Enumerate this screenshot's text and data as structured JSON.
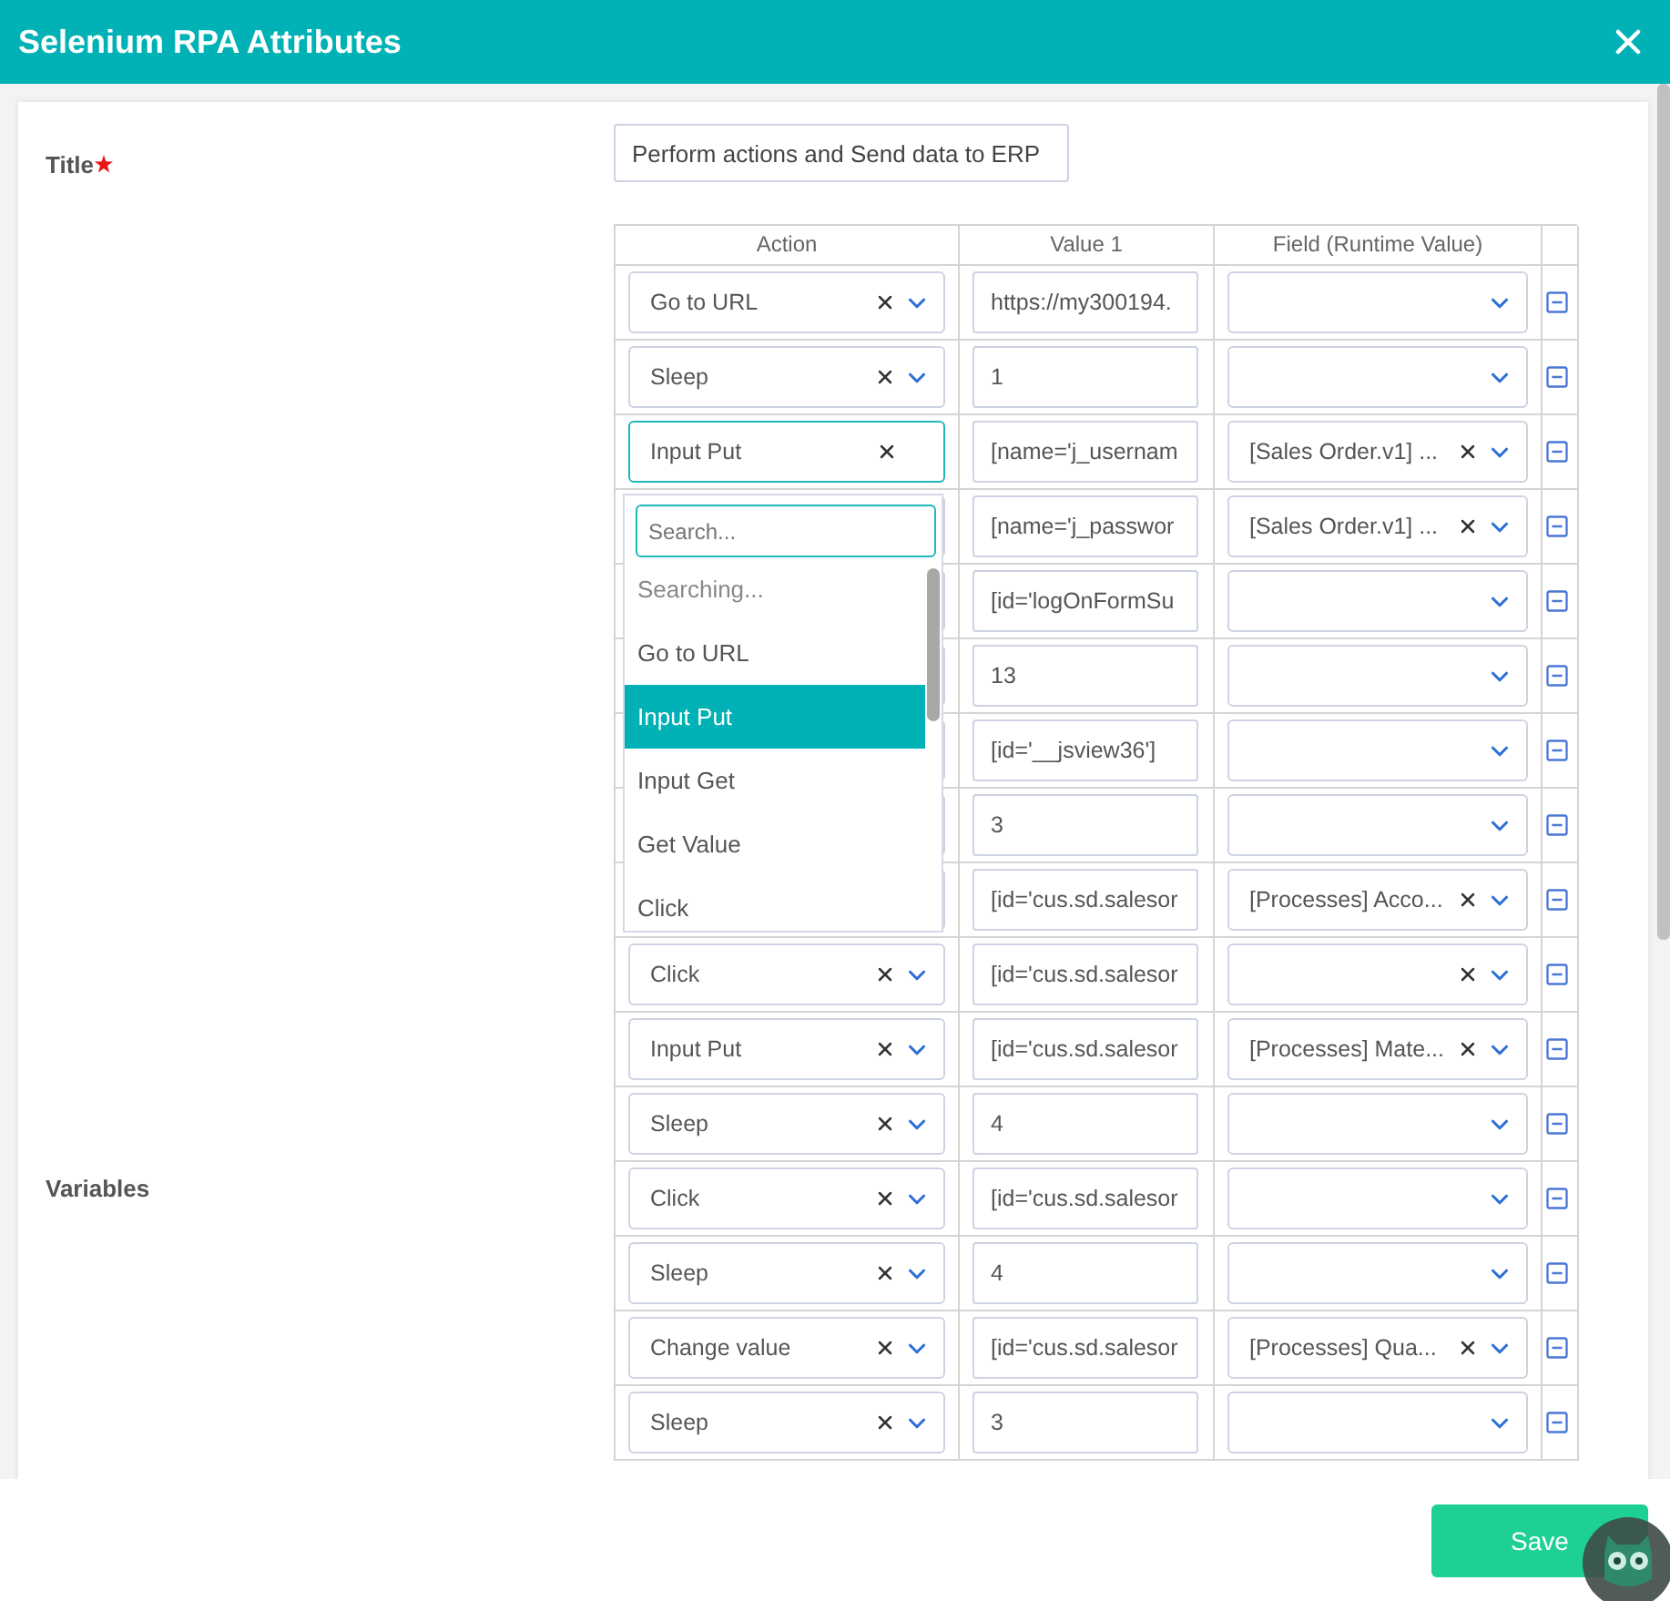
{
  "window": {
    "title": "Selenium RPA Attributes"
  },
  "title_field": {
    "label": "Title",
    "required": true,
    "value": "Perform actions and Send data to ERP"
  },
  "variables": {
    "label": "Variables"
  },
  "table": {
    "columns": [
      "Action",
      "Value 1",
      "Field (Runtime Value)"
    ],
    "rows": [
      {
        "action": "Go to URL",
        "open": false,
        "value": "https://my300194.",
        "field": "",
        "field_clear": false
      },
      {
        "action": "Sleep",
        "open": false,
        "value": "1",
        "field": "",
        "field_clear": false
      },
      {
        "action": "Input Put",
        "open": true,
        "value": "[name='j_usernam",
        "field": "[Sales Order.v1] ...",
        "field_clear": true
      },
      {
        "value": "[name='j_passwor",
        "field": "[Sales Order.v1] ...",
        "field_clear": true
      },
      {
        "value": "[id='logOnFormSu",
        "field": "",
        "field_clear": false
      },
      {
        "value": "13",
        "field": "",
        "field_clear": false
      },
      {
        "value": "[id='__jsview36']",
        "field": "",
        "field_clear": false
      },
      {
        "value": "3",
        "field": "",
        "field_clear": false
      },
      {
        "value": "[id='cus.sd.salesor",
        "field": "[Processes] Acco...",
        "field_clear": true
      },
      {
        "action": "Click",
        "open": false,
        "value": "[id='cus.sd.salesor",
        "field": "",
        "field_clear": true
      },
      {
        "action": "Input Put",
        "open": false,
        "value": "[id='cus.sd.salesor",
        "field": "[Processes] Mate...",
        "field_clear": true
      },
      {
        "action": "Sleep",
        "open": false,
        "value": "4",
        "field": "",
        "field_clear": false
      },
      {
        "action": "Click",
        "open": false,
        "value": "[id='cus.sd.salesor",
        "field": "",
        "field_clear": false
      },
      {
        "action": "Sleep",
        "open": false,
        "value": "4",
        "field": "",
        "field_clear": false
      },
      {
        "action": "Change value",
        "open": false,
        "value": "[id='cus.sd.salesor",
        "field": "[Processes] Qua...",
        "field_clear": true
      },
      {
        "action": "Sleep",
        "open": false,
        "value": "3",
        "field": "",
        "field_clear": false
      }
    ]
  },
  "dropdown": {
    "placeholder": "Search...",
    "status": "Searching...",
    "options": [
      {
        "label": "Go to URL",
        "selected": false
      },
      {
        "label": "Input Put",
        "selected": true
      },
      {
        "label": "Input Get",
        "selected": false
      },
      {
        "label": "Get Value",
        "selected": false
      },
      {
        "label": "Click",
        "selected": false
      }
    ]
  },
  "footer": {
    "save": "Save"
  }
}
